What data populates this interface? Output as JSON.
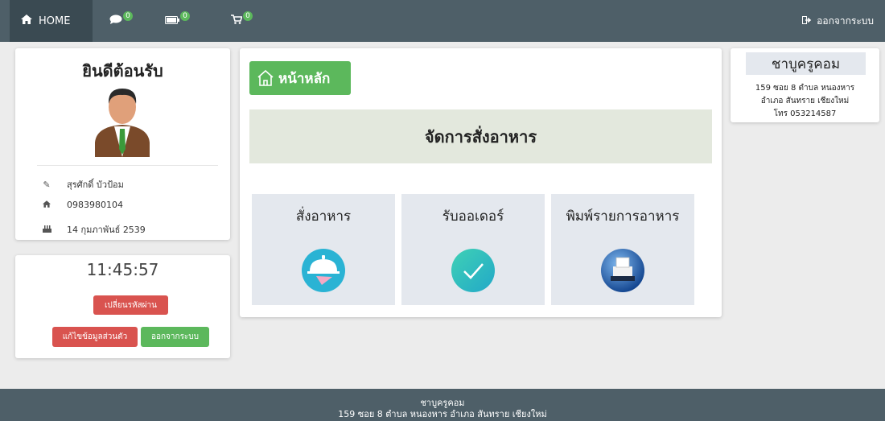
{
  "colors": {
    "navbar": "#4e5f68",
    "accent_green": "#5cb85c",
    "accent_red": "#d9534f"
  },
  "navbar": {
    "home_label": "HOME",
    "home_icon": "home-icon",
    "items": [
      {
        "icon": "comment-icon",
        "badge": "0"
      },
      {
        "icon": "battery-icon",
        "badge": "0"
      },
      {
        "icon": "cart-icon",
        "badge": "0"
      }
    ],
    "logout_label": "ออกจากระบบ",
    "logout_icon": "sign-out-icon"
  },
  "profile": {
    "welcome": "ยินดีต้อนรับ",
    "name": "สุรศักดิ์ บัวป้อม",
    "phone": "0983980104",
    "birthday": "14 กุมภาพันธ์ 2539"
  },
  "clock": {
    "time": "11:45:57",
    "change_password": "เปลี่ยนรหัสผ่าน",
    "edit_profile": "แก้ไขข้อมูลส่วนตัว",
    "logout": "ออกจากระบบ"
  },
  "main": {
    "home_button": "หน้าหลัก",
    "section_title": "จัดการสั่งอาหาร",
    "tiles": [
      {
        "label": "สั่งอาหาร",
        "icon": "food-service-icon"
      },
      {
        "label": "รับออเดอร์",
        "icon": "check-icon"
      },
      {
        "label": "พิมพ์รายการอาหาร",
        "icon": "printer-icon"
      }
    ]
  },
  "shop": {
    "name": "ชาบูครูคอม",
    "address_line1": "159 ซอย 8 ตำบล หนองหาร",
    "address_line2": "อำเภอ สันทราย เชียงใหม่",
    "phone_line": "โทร 053214587"
  },
  "footer": {
    "title": "ชาบูครูคอม",
    "address": "159 ซอย 8 ตำบล หนองหาร อำเภอ สันทราย เชียงใหม่"
  }
}
